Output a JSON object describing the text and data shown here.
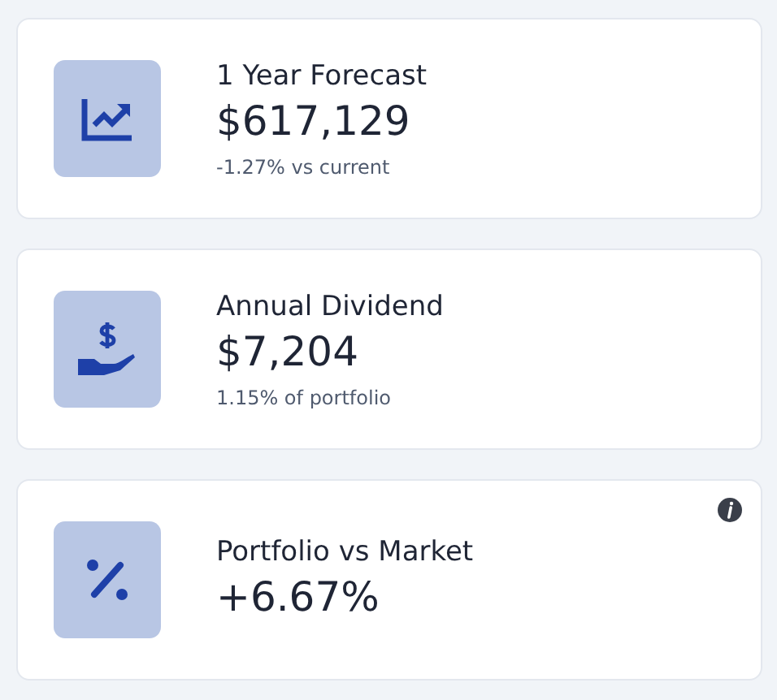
{
  "cards": [
    {
      "kind": "chart",
      "title": "1 Year Forecast",
      "value": "$617,129",
      "note": "-1.27% vs current",
      "info": false
    },
    {
      "kind": "dividend",
      "title": "Annual Dividend",
      "value": "$7,204",
      "note": "1.15% of portfolio",
      "info": false
    },
    {
      "kind": "percent",
      "title": "Portfolio vs Market",
      "value": "+6.67%",
      "info": true
    }
  ]
}
